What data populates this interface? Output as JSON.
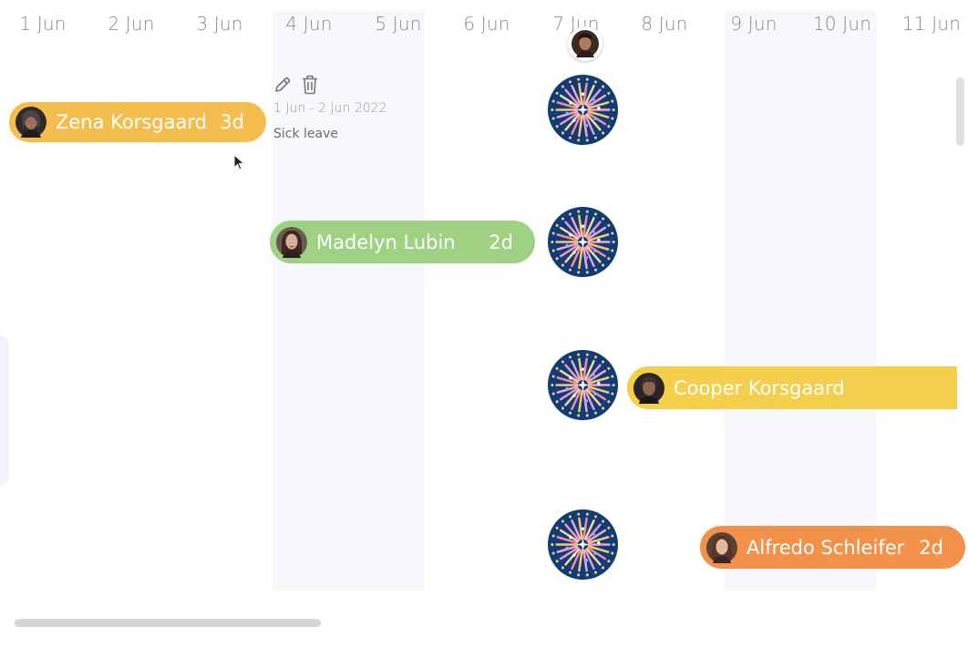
{
  "timeline": {
    "days": [
      "1 Jun",
      "2 Jun",
      "3 Jun",
      "4 Jun",
      "5 Jun",
      "6 Jun",
      "7 Jun",
      "8 Jun",
      "9 Jun",
      "10 Jun",
      "11 Jun"
    ]
  },
  "bars": {
    "zena": {
      "name": "Zena Korsgaard",
      "duration": "3d",
      "color": "#f4be4f"
    },
    "madelyn": {
      "name": "Madelyn Lubin",
      "duration": "2d",
      "color": "#9ed282"
    },
    "cooper": {
      "name": "Cooper Korsgaard",
      "color": "#f4cf4c"
    },
    "alfredo": {
      "name": "Alfredo Schleifer",
      "duration": "2d",
      "color": "#f29149"
    }
  },
  "popup": {
    "date_range": "1 Jun - 2 Jun 2022",
    "leave_type": "Sick leave",
    "edit_icon": "pencil-icon",
    "delete_icon": "trash-icon"
  },
  "holiday": {
    "icon": "fireworks-icon"
  },
  "colors": {
    "weekend_band": "#f7f8fc",
    "holiday_bg": "#0f3b78"
  }
}
